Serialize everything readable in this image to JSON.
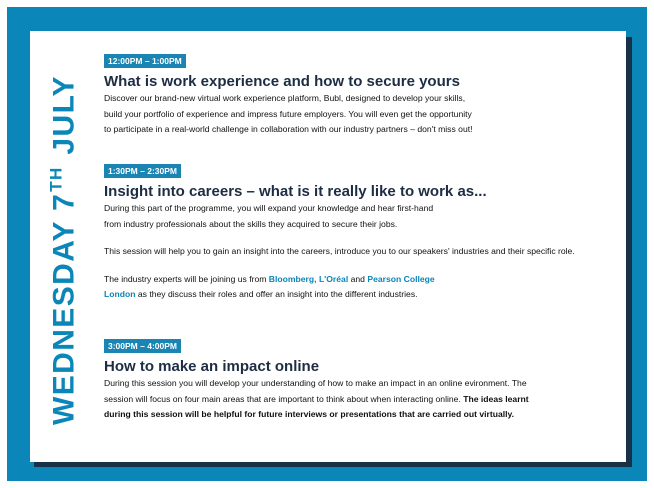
{
  "day": {
    "prefix": "WEDNESDAY 7",
    "suffix": "TH",
    "month": "JULY"
  },
  "sessions": [
    {
      "time": "12:00PM – 1:00PM",
      "title": "What is work experience and how to secure yours",
      "lines": [
        "Discover our brand-new virtual work experience platform, Bubl, designed to develop your skills,",
        "build your portfolio of experience and impress future employers. You will even get the opportunity",
        "to participate in a real-world challenge in collaboration with our industry partners – don't miss out!"
      ]
    },
    {
      "time": "1:30PM – 2:30PM",
      "title": "Insight into careers – what is it really like to work as...",
      "lines": [
        "During this part of the programme, you will expand your knowledge and hear first-hand",
        "from industry professionals about the skills they acquired to secure their jobs."
      ],
      "para2": "This session will help you to gain an insight into the careers, introduce you to our speakers' industries and their specific role.",
      "para3": {
        "t1": "The industry experts will be joining us from ",
        "p1": "Bloomberg",
        "t2": ", ",
        "p2": "L'Oréal",
        "t3": " and ",
        "p3a": "Pearson College",
        "p3b": "London",
        "t4": " as they discuss their roles and offer an insight into the different industries."
      }
    },
    {
      "time": "3:00PM – 4:00PM",
      "title": "How to make an impact online",
      "line1": "During this session you will develop your understanding of how to make an impact in an online evironment. The",
      "line2a": "session will focus on four main areas that are important to think about when interacting online. ",
      "line2b": "The ideas learnt",
      "line3": "during this session will be helpful for future interviews or presentations that are carried out virtually."
    }
  ]
}
